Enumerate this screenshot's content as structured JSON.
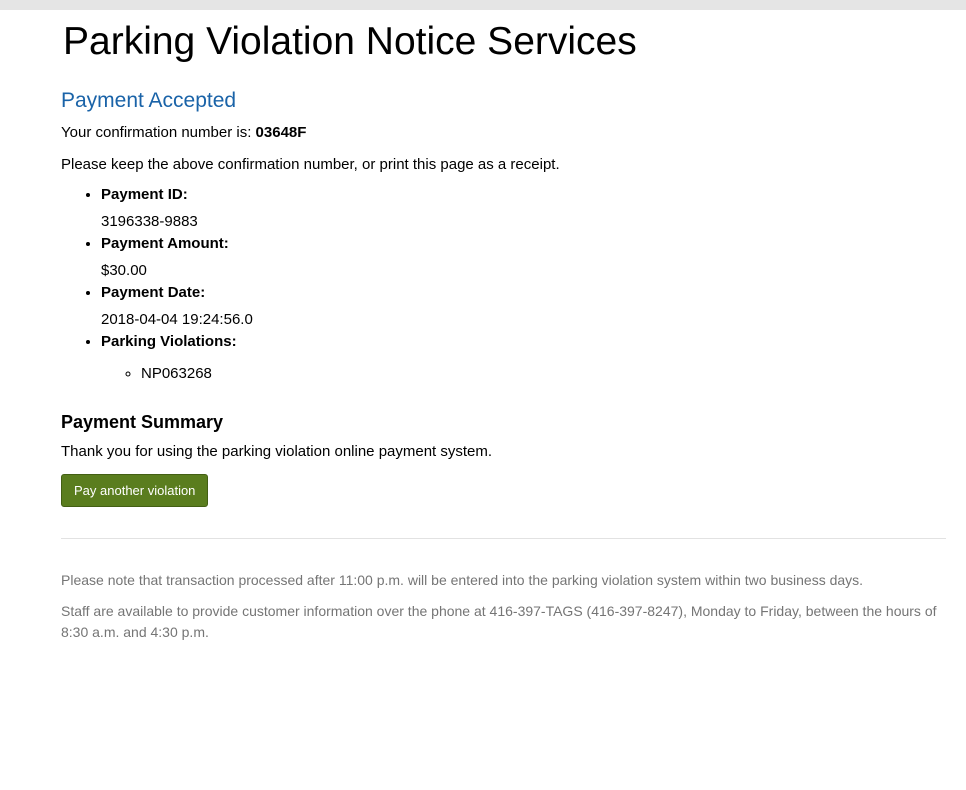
{
  "header": {
    "title": "Parking Violation Notice Services"
  },
  "status": {
    "heading": "Payment Accepted",
    "confirmation_prefix": "Your confirmation number is: ",
    "confirmation_number": "03648F",
    "keep_note": "Please keep the above confirmation number, or print this page as a receipt."
  },
  "details": {
    "payment_id_label": "Payment ID:",
    "payment_id_value": "3196338-9883",
    "amount_label": "Payment Amount:",
    "amount_value": "$30.00",
    "date_label": "Payment Date:",
    "date_value": "2018-04-04 19:24:56.0",
    "violations_label": "Parking Violations:",
    "violations": [
      "NP063268"
    ]
  },
  "summary": {
    "heading": "Payment Summary",
    "thanks": "Thank you for using the parking violation online payment system.",
    "button_label": "Pay another violation"
  },
  "footer": {
    "note_1": "Please note that transaction processed after 11:00 p.m. will be entered into the parking violation system within two business days.",
    "note_2": "Staff are available to provide customer information over the phone at 416-397-TAGS (416-397-8247), Monday to Friday, between the hours of 8:30 a.m. and 4:30 p.m."
  },
  "colors": {
    "heading_blue": "#1a63a8",
    "button_green": "#5a7d1e",
    "footnote_gray": "#757575",
    "top_bar_gray": "#e5e5e5"
  }
}
